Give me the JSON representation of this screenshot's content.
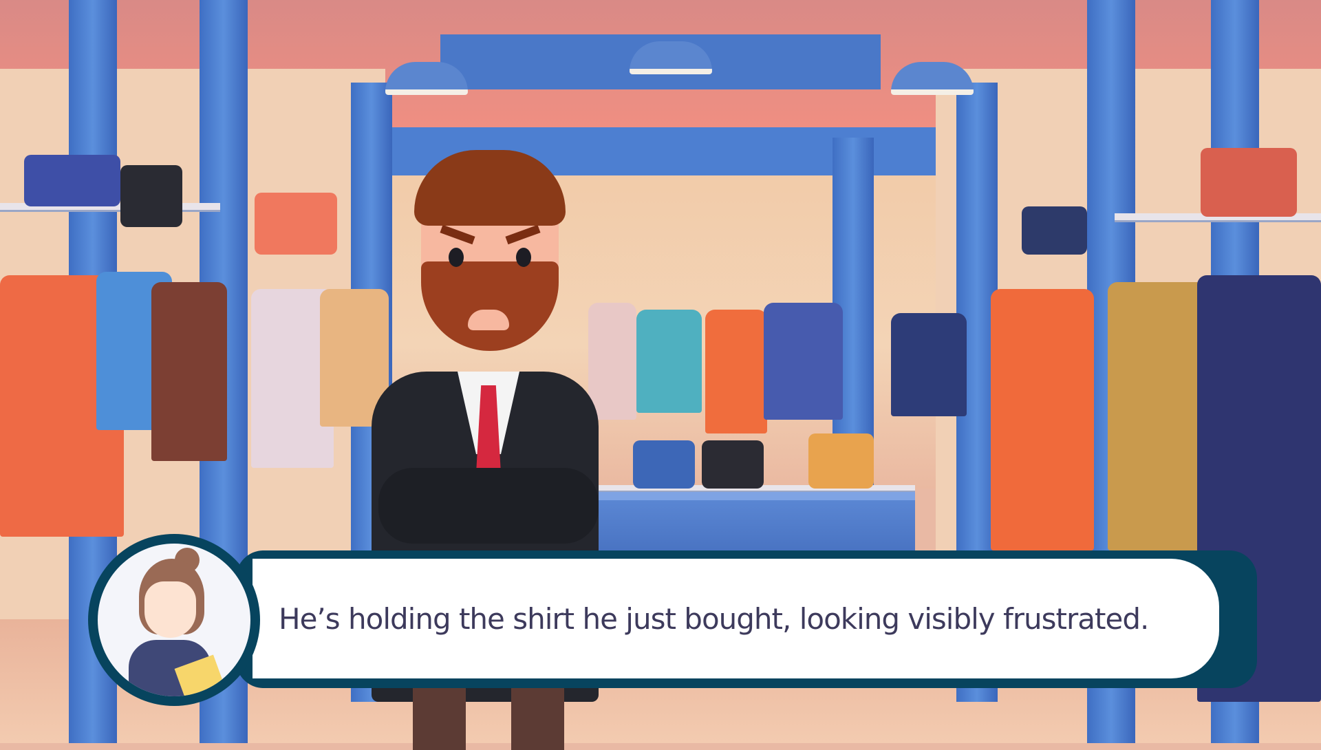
{
  "dialog": {
    "text": "He’s holding the shirt he just bought, looking visibly frustrated."
  },
  "icons": {
    "narrator": "narrator-avatar",
    "character": "frustrated-man"
  },
  "colors": {
    "dialog_frame": "#07445e",
    "dialog_text": "#3d3a5c"
  }
}
